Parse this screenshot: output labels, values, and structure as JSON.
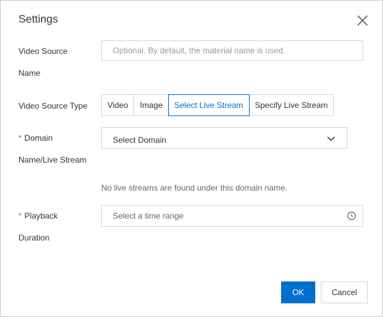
{
  "dialog": {
    "title": "Settings",
    "close_icon": "close-icon"
  },
  "video_source_name": {
    "label_line1": "Video Source",
    "label_line2": "Name",
    "placeholder": "Optional. By default, the material name is used.",
    "value": ""
  },
  "video_source_type": {
    "label": "Video Source Type",
    "options": [
      "Video",
      "Image",
      "Select Live Stream",
      "Specify Live Stream"
    ],
    "selected": "Select Live Stream"
  },
  "domain": {
    "required_mark": "*",
    "label_line1": "Domain",
    "label_line2": "Name/Live Stream",
    "value": "Select Domain",
    "icon": "chevron-down-icon",
    "hint": "No live streams are found under this domain name."
  },
  "playback": {
    "required_mark": "*",
    "label_line1": "Playback",
    "label_line2": "Duration",
    "placeholder": "Select a time range",
    "icon": "clock-icon"
  },
  "footer": {
    "ok_label": "OK",
    "cancel_label": "Cancel"
  },
  "colors": {
    "primary": "#0070cc",
    "required": "#f04134",
    "border": "#d7d7d7"
  }
}
